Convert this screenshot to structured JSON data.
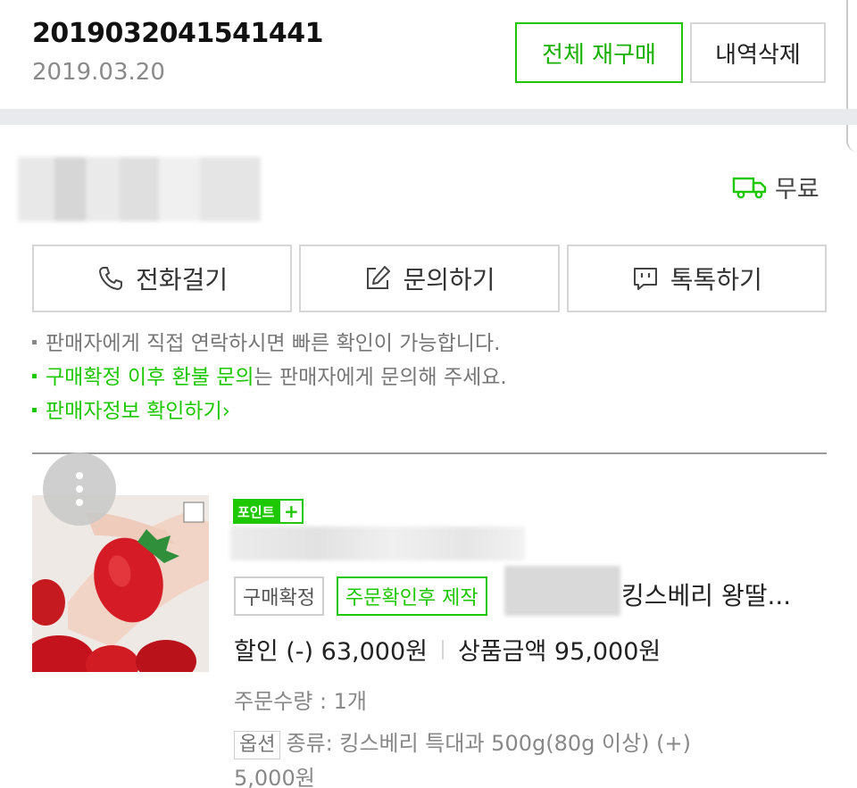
{
  "order": {
    "number": "20190320415414 41",
    "number_display": "2019032041541441",
    "date": "2019.03.20",
    "reorder_label": "전체 재구매",
    "delete_label": "내역삭제"
  },
  "seller": {
    "shipping_text": "무료"
  },
  "contact": {
    "call_label": "전화걸기",
    "inquiry_label": "문의하기",
    "talk_label": "톡톡하기"
  },
  "notices": {
    "line1": "판매자에게 직접 연락하시면 빠른 확인이 가능합니다.",
    "line2_highlight": "구매확정 이후 환불 문의",
    "line2_rest": "는 판매자에게 문의해 주세요.",
    "line3_link": "판매자정보 확인하기"
  },
  "product": {
    "point_badge": "포인트",
    "point_plus": "+",
    "status_tag": "구매확정",
    "made_tag": "주문확인후 제작",
    "title": "킹스베리 왕딸...",
    "discount": "할인 (-) 63,000원",
    "price": "상품금액 95,000원",
    "quantity": "주문수량 : 1개",
    "option_tag": "옵션",
    "option_text": "종류: 킹스베리 특대과 500g(80g 이상) (+)",
    "option_price": "5,000원"
  },
  "colors": {
    "accent_green": "#1ec800",
    "divider_gray": "#e8eaee"
  },
  "icons": [
    "truck-icon",
    "phone-icon",
    "edit-icon",
    "chat-icon",
    "more-vertical-icon",
    "strawberry-photo"
  ]
}
